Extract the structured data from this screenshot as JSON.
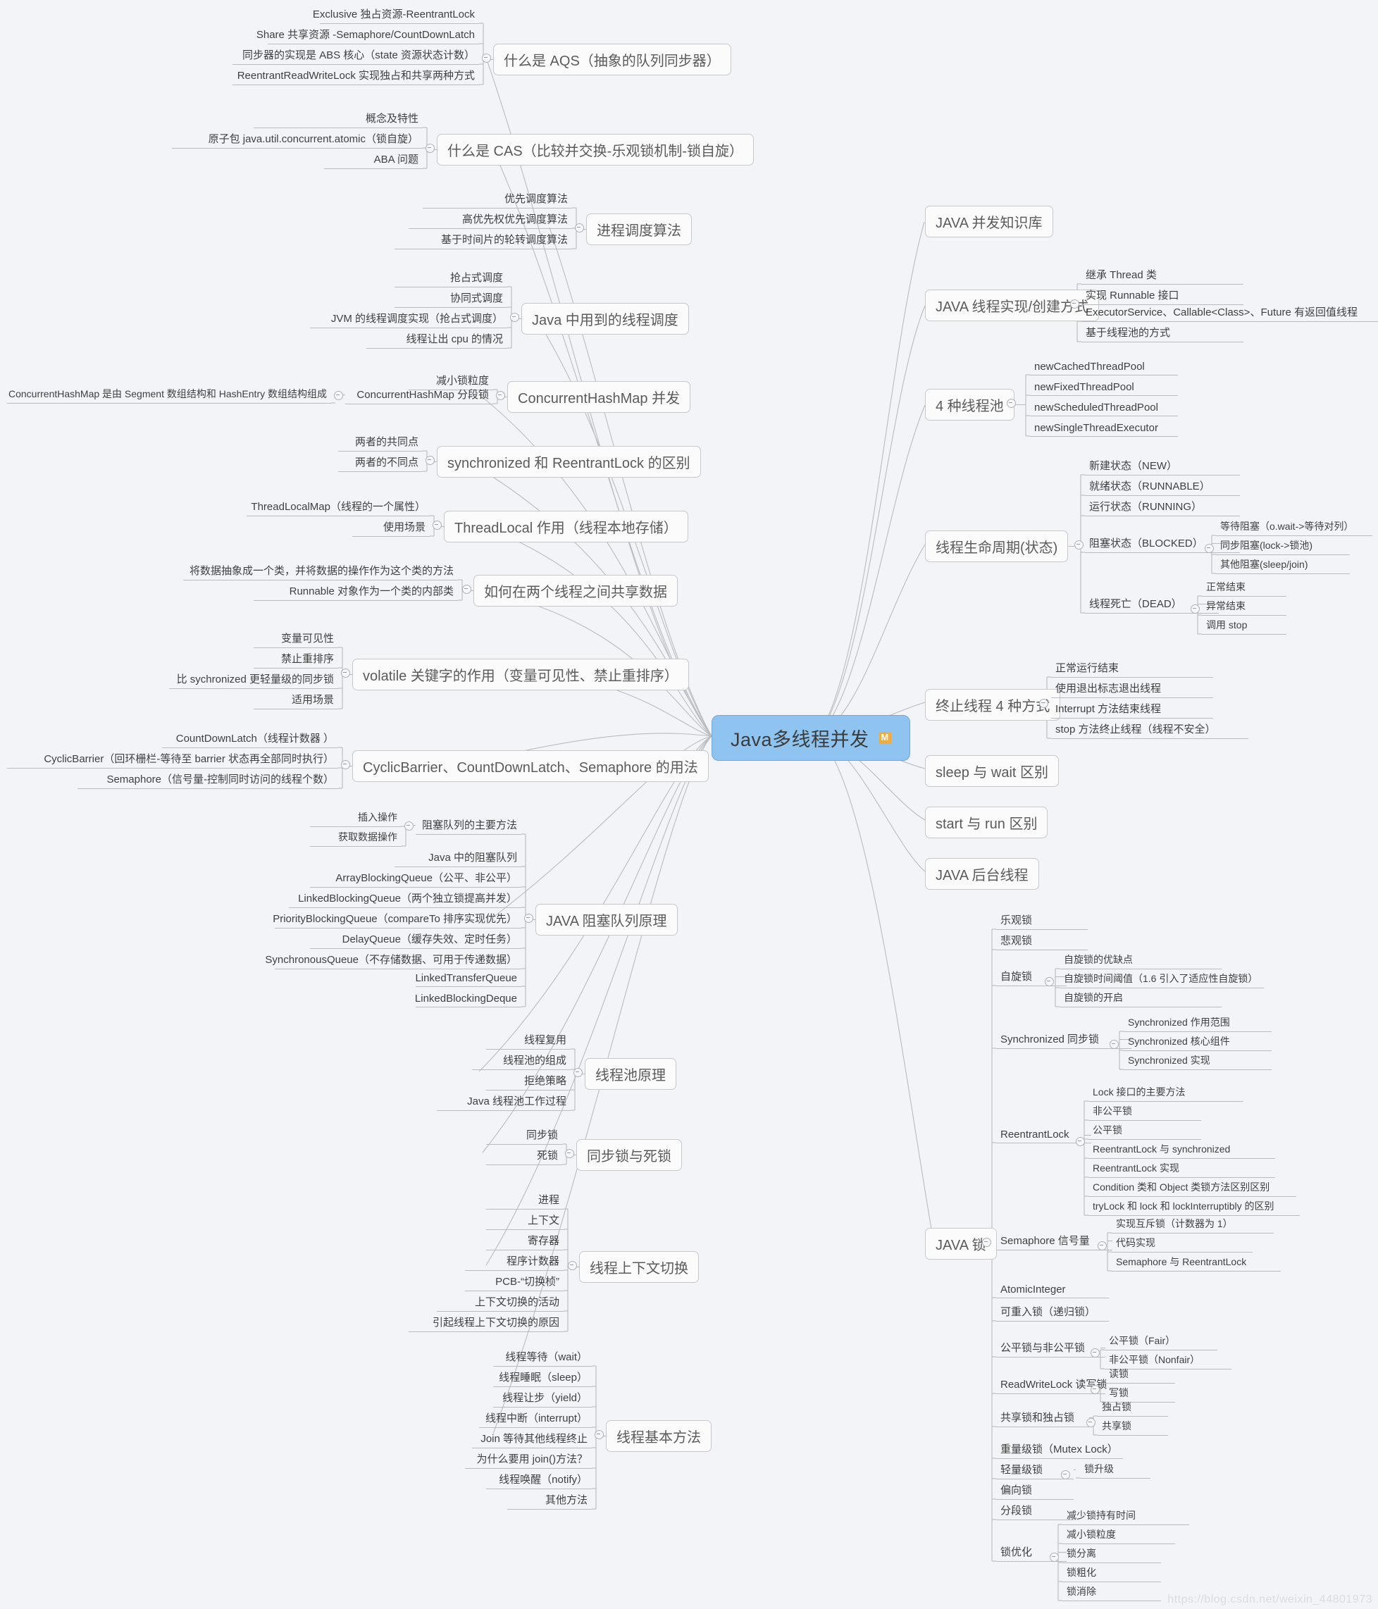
{
  "root": {
    "label": "Java多线程并发",
    "badge": "M",
    "color": "#8fc4f0"
  },
  "watermark": "https://blog.csdn.net/weixin_44801973",
  "left_branches": [
    {
      "label": "什么是 AQS（抽象的队列同步器）",
      "children": [
        {
          "label": "Exclusive 独占资源-ReentrantLock"
        },
        {
          "label": "Share 共享资源 -Semaphore/CountDownLatch"
        },
        {
          "label": "同步器的实现是 ABS 核心（state 资源状态计数）"
        },
        {
          "label": "ReentrantReadWriteLock 实现独占和共享两种方式"
        }
      ]
    },
    {
      "label": "什么是 CAS（比较并交换-乐观锁机制-锁自旋）",
      "children": [
        {
          "label": "概念及特性"
        },
        {
          "label": "原子包 java.util.concurrent.atomic（锁自旋）"
        },
        {
          "label": "ABA 问题"
        }
      ]
    },
    {
      "label": "进程调度算法",
      "children": [
        {
          "label": "优先调度算法"
        },
        {
          "label": "高优先权优先调度算法"
        },
        {
          "label": "基于时间片的轮转调度算法"
        }
      ]
    },
    {
      "label": "Java 中用到的线程调度",
      "children": [
        {
          "label": "抢占式调度"
        },
        {
          "label": "协同式调度"
        },
        {
          "label": "JVM 的线程调度实现（抢占式调度）"
        },
        {
          "label": "线程让出 cpu 的情况"
        }
      ]
    },
    {
      "label": "ConcurrentHashMap 并发",
      "children": [
        {
          "label": "减小锁粒度"
        },
        {
          "label": "ConcurrentHashMap 分段锁",
          "children": [
            {
              "label": "ConcurrentHashMap 是由 Segment 数组结构和 HashEntry 数组结构组成"
            }
          ]
        }
      ]
    },
    {
      "label": "synchronized 和 ReentrantLock 的区别",
      "children": [
        {
          "label": "两者的共同点"
        },
        {
          "label": "两者的不同点"
        }
      ]
    },
    {
      "label": "ThreadLocal 作用（线程本地存储）",
      "children": [
        {
          "label": "ThreadLocalMap（线程的一个属性）"
        },
        {
          "label": "使用场景"
        }
      ]
    },
    {
      "label": "如何在两个线程之间共享数据",
      "children": [
        {
          "label": "将数据抽象成一个类，并将数据的操作作为这个类的方法"
        },
        {
          "label": "Runnable 对象作为一个类的内部类"
        }
      ]
    },
    {
      "label": "volatile 关键字的作用（变量可见性、禁止重排序）",
      "children": [
        {
          "label": "变量可见性"
        },
        {
          "label": "禁止重排序"
        },
        {
          "label": "比 sychronized 更轻量级的同步锁"
        },
        {
          "label": "适用场景"
        }
      ]
    },
    {
      "label": "CyclicBarrier、CountDownLatch、Semaphore 的用法",
      "children": [
        {
          "label": "CountDownLatch（线程计数器 ）"
        },
        {
          "label": "CyclicBarrier（回环栅栏-等待至 barrier 状态再全部同时执行）"
        },
        {
          "label": "Semaphore（信号量-控制同时访问的线程个数）"
        }
      ]
    },
    {
      "label": "JAVA 阻塞队列原理",
      "children": [
        {
          "label": "阻塞队列的主要方法",
          "children": [
            {
              "label": "插入操作"
            },
            {
              "label": "获取数据操作"
            }
          ]
        },
        {
          "label": "Java 中的阻塞队列"
        },
        {
          "label": "ArrayBlockingQueue（公平、非公平）"
        },
        {
          "label": "LinkedBlockingQueue（两个独立锁提高并发）"
        },
        {
          "label": "PriorityBlockingQueue（compareTo 排序实现优先）"
        },
        {
          "label": "DelayQueue（缓存失效、定时任务）"
        },
        {
          "label": "SynchronousQueue（不存储数据、可用于传递数据）"
        },
        {
          "label": "LinkedTransferQueue"
        },
        {
          "label": "LinkedBlockingDeque"
        }
      ]
    },
    {
      "label": "线程池原理",
      "children": [
        {
          "label": "线程复用"
        },
        {
          "label": "线程池的组成"
        },
        {
          "label": "拒绝策略"
        },
        {
          "label": "Java 线程池工作过程"
        }
      ]
    },
    {
      "label": "同步锁与死锁",
      "children": [
        {
          "label": "同步锁"
        },
        {
          "label": "死锁"
        }
      ]
    },
    {
      "label": "线程上下文切换",
      "children": [
        {
          "label": "进程"
        },
        {
          "label": "上下文"
        },
        {
          "label": "寄存器"
        },
        {
          "label": "程序计数器"
        },
        {
          "label": "PCB-“切换桢”"
        },
        {
          "label": "上下文切换的活动"
        },
        {
          "label": "引起线程上下文切换的原因"
        }
      ]
    },
    {
      "label": "线程基本方法",
      "children": [
        {
          "label": "线程等待（wait）"
        },
        {
          "label": "线程睡眠（sleep）"
        },
        {
          "label": "线程让步（yield）"
        },
        {
          "label": "线程中断（interrupt）"
        },
        {
          "label": "Join 等待其他线程终止"
        },
        {
          "label": "为什么要用 join()方法？"
        },
        {
          "label": "线程唤醒（notify）"
        },
        {
          "label": "其他方法"
        }
      ]
    }
  ],
  "right_branches": [
    {
      "label": "JAVA 并发知识库",
      "children": []
    },
    {
      "label": "JAVA 线程实现/创建方式",
      "children": [
        {
          "label": "继承 Thread 类"
        },
        {
          "label": "实现 Runnable 接口"
        },
        {
          "label": "ExecutorService、Callable<Class>、Future 有返回值线程"
        },
        {
          "label": "基于线程池的方式"
        }
      ]
    },
    {
      "label": "4 种线程池",
      "children": [
        {
          "label": "newCachedThreadPool"
        },
        {
          "label": "newFixedThreadPool"
        },
        {
          "label": "newScheduledThreadPool"
        },
        {
          "label": "newSingleThreadExecutor"
        }
      ]
    },
    {
      "label": "线程生命周期(状态)",
      "children": [
        {
          "label": "新建状态（NEW）"
        },
        {
          "label": "就绪状态（RUNNABLE）"
        },
        {
          "label": "运行状态（RUNNING）"
        },
        {
          "label": "阻塞状态（BLOCKED）",
          "children": [
            {
              "label": "等待阻塞（o.wait->等待对列）"
            },
            {
              "label": "同步阻塞(lock->锁池)"
            },
            {
              "label": "其他阻塞(sleep/join)"
            }
          ]
        },
        {
          "label": "线程死亡（DEAD）",
          "children": [
            {
              "label": "正常结束"
            },
            {
              "label": "异常结束"
            },
            {
              "label": "调用 stop"
            }
          ]
        }
      ]
    },
    {
      "label": "终止线程 4 种方式",
      "children": [
        {
          "label": "正常运行结束"
        },
        {
          "label": "使用退出标志退出线程"
        },
        {
          "label": "Interrupt 方法结束线程"
        },
        {
          "label": "stop 方法终止线程（线程不安全）"
        }
      ]
    },
    {
      "label": "sleep 与 wait 区别",
      "children": []
    },
    {
      "label": "start 与 run 区别",
      "children": []
    },
    {
      "label": "JAVA 后台线程",
      "children": []
    },
    {
      "label": "JAVA 锁",
      "children": [
        {
          "label": "乐观锁"
        },
        {
          "label": "悲观锁"
        },
        {
          "label": "自旋锁",
          "children": [
            {
              "label": "自旋锁的优缺点"
            },
            {
              "label": "自旋锁时间阈值（1.6 引入了适应性自旋锁）"
            },
            {
              "label": "自旋锁的开启"
            }
          ]
        },
        {
          "label": "Synchronized 同步锁",
          "children": [
            {
              "label": "Synchronized 作用范围"
            },
            {
              "label": "Synchronized 核心组件"
            },
            {
              "label": "Synchronized 实现"
            }
          ]
        },
        {
          "label": "ReentrantLock",
          "children": [
            {
              "label": "Lock 接口的主要方法"
            },
            {
              "label": "非公平锁"
            },
            {
              "label": "公平锁"
            },
            {
              "label": "ReentrantLock 与 synchronized"
            },
            {
              "label": "ReentrantLock 实现"
            },
            {
              "label": "Condition 类和 Object 类锁方法区别区别"
            },
            {
              "label": "tryLock 和 lock 和 lockInterruptibly 的区别"
            }
          ]
        },
        {
          "label": "Semaphore 信号量",
          "children": [
            {
              "label": "实现互斥锁（计数器为 1）"
            },
            {
              "label": "代码实现"
            },
            {
              "label": "Semaphore 与 ReentrantLock"
            }
          ]
        },
        {
          "label": "AtomicInteger"
        },
        {
          "label": "可重入锁（递归锁）"
        },
        {
          "label": "公平锁与非公平锁",
          "children": [
            {
              "label": "公平锁（Fair）"
            },
            {
              "label": "非公平锁（Nonfair）"
            }
          ]
        },
        {
          "label": "ReadWriteLock 读写锁",
          "children": [
            {
              "label": "读锁"
            },
            {
              "label": "写锁"
            }
          ]
        },
        {
          "label": "共享锁和独占锁",
          "children": [
            {
              "label": "独占锁"
            },
            {
              "label": "共享锁"
            }
          ]
        },
        {
          "label": "重量级锁（Mutex Lock）"
        },
        {
          "label": "轻量级锁",
          "children": [
            {
              "label": "锁升级"
            }
          ]
        },
        {
          "label": "偏向锁"
        },
        {
          "label": "分段锁"
        },
        {
          "label": "锁优化",
          "children": [
            {
              "label": "减少锁持有时间"
            },
            {
              "label": "减小锁粒度"
            },
            {
              "label": "锁分离"
            },
            {
              "label": "锁粗化"
            },
            {
              "label": "锁消除"
            }
          ]
        }
      ]
    }
  ]
}
